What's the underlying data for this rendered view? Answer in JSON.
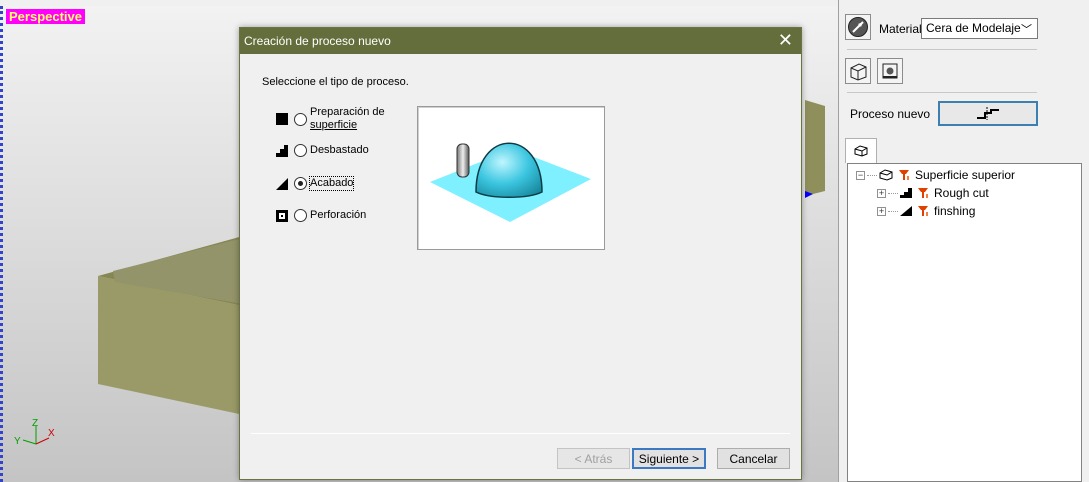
{
  "viewport": {
    "label": "Perspective",
    "axes": {
      "z": "Z",
      "y": "Y",
      "x": "X"
    }
  },
  "right_panel": {
    "material_label": "Material",
    "material_value": "Cera de Modelaje",
    "proceso_label": "Proceso nuevo",
    "tree": {
      "root": "Superficie superior",
      "children": [
        "Rough cut",
        "finshing"
      ]
    }
  },
  "dialog": {
    "title": "Creación de proceso nuevo",
    "prompt": "Seleccione el tipo de proceso.",
    "options": [
      {
        "label_line1": "Preparación de",
        "label_line2": "superficie",
        "icon": "square-icon",
        "selected": false
      },
      {
        "label": "Desbastado",
        "icon": "steps-icon",
        "selected": false
      },
      {
        "label": "Acabado",
        "icon": "slope-icon",
        "selected": true
      },
      {
        "label": "Perforación",
        "icon": "drill-hole-icon",
        "selected": false
      }
    ],
    "buttons": {
      "back": "< Atrás",
      "next": "Siguiente >",
      "cancel": "Cancelar"
    }
  },
  "colors": {
    "titlebar": "#646e3c",
    "stock_box": "#8f8f5c",
    "toolpath": "#0000ff",
    "preview_plane": "#7ff0ff",
    "preview_dome": "#3cc6e0",
    "default_button_border": "#3b7ac2",
    "viewport_label_bg": "#ff00ff"
  }
}
